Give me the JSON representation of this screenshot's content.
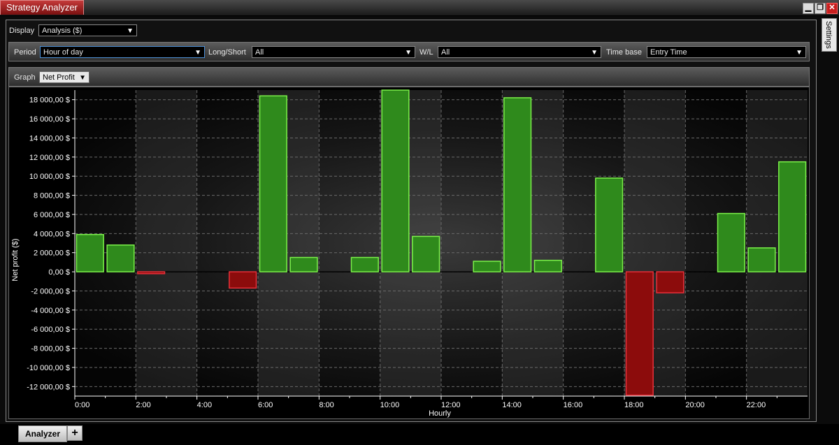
{
  "window": {
    "title": "Strategy Analyzer",
    "minimize_icon": "minimize-icon",
    "restore_icon": "restore-icon",
    "close_icon": "close-icon"
  },
  "side_tab": {
    "label": "Settings"
  },
  "display": {
    "label": "Display",
    "value": "Analysis ($)"
  },
  "filters": {
    "period_label": "Period",
    "period_value": "Hour of day",
    "longshort_label": "Long/Short",
    "longshort_value": "All",
    "wl_label": "W/L",
    "wl_value": "All",
    "timebase_label": "Time base",
    "timebase_value": "Entry Time"
  },
  "graph": {
    "label": "Graph",
    "value": "Net Profit"
  },
  "bottom_tabs": {
    "active": "Analyzer",
    "add": "+"
  },
  "colors": {
    "positive_fill": "#2f8a1c",
    "positive_stroke": "#7cf24a",
    "negative_fill": "#8c0c0c",
    "negative_stroke": "#e8303a"
  },
  "chart_data": {
    "type": "bar",
    "xlabel": "Hourly",
    "ylabel": "Net profit ($)",
    "ylim": [
      -13000,
      19000
    ],
    "yticks": [
      18000,
      16000,
      14000,
      12000,
      10000,
      8000,
      6000,
      4000,
      2000,
      0,
      -2000,
      -4000,
      -6000,
      -8000,
      -10000,
      -12000
    ],
    "ytick_labels": [
      "18 000,00 $",
      "16 000,00 $",
      "14 000,00 $",
      "12 000,00 $",
      "10 000,00 $",
      "8 000,00 $",
      "6 000,00 $",
      "4 000,00 $",
      "2 000,00 $",
      "0,00 $",
      "-2 000,00 $",
      "-4 000,00 $",
      "-6 000,00 $",
      "-8 000,00 $",
      "-10 000,00 $",
      "-12 000,00 $"
    ],
    "xtick_labels": [
      "0:00",
      "2:00",
      "4:00",
      "6:00",
      "8:00",
      "10:00",
      "12:00",
      "14:00",
      "16:00",
      "18:00",
      "20:00",
      "22:00"
    ],
    "categories": [
      "0",
      "1",
      "2",
      "3",
      "4",
      "5",
      "6",
      "7",
      "8",
      "9",
      "10",
      "11",
      "12",
      "13",
      "14",
      "15",
      "16",
      "17",
      "18",
      "19",
      "20",
      "21",
      "22",
      "23"
    ],
    "values": [
      3900,
      2800,
      -200,
      0,
      0,
      -1700,
      18400,
      1500,
      0,
      1500,
      19000,
      3700,
      0,
      1100,
      18200,
      1200,
      0,
      9800,
      -12900,
      -2200,
      0,
      6100,
      2500,
      11500
    ],
    "grid": true
  }
}
